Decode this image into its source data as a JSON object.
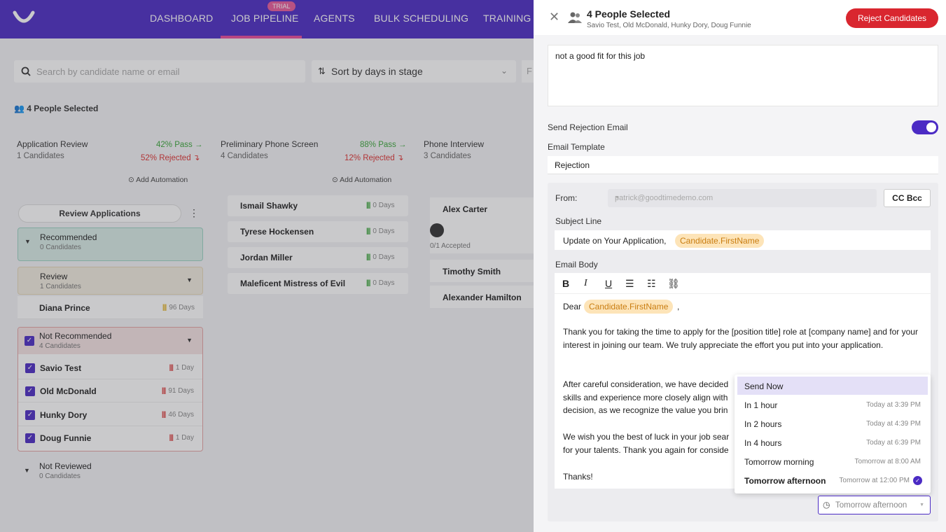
{
  "nav": {
    "items": [
      "DASHBOARD",
      "JOB PIPELINE",
      "AGENTS",
      "BULK SCHEDULING",
      "TRAINING"
    ],
    "badge": "TRIAL",
    "accent": "#4b2bc4"
  },
  "toolbar": {
    "search_placeholder": "Search by candidate name or email",
    "sort_label": "Sort by days in stage",
    "filter_label": "F"
  },
  "selection_label": "4 People Selected",
  "stages": [
    {
      "title": "Application Review",
      "count": "1 Candidates",
      "pass": "42% Pass →",
      "rejected": "52% Rejected ↴",
      "automation": "Add Automation"
    },
    {
      "title": "Preliminary Phone Screen",
      "count": "4 Candidates",
      "pass": "88% Pass →",
      "rejected": "12% Rejected ↴",
      "automation": "Add Automation"
    },
    {
      "title": "Phone Interview",
      "count": "3 Candidates"
    }
  ],
  "review_button": "Review Applications",
  "groups": {
    "recommended": {
      "title": "Recommended",
      "count": "0 Candidates"
    },
    "review": {
      "title": "Review",
      "count": "1 Candidates"
    },
    "not_recommended": {
      "title": "Not Recommended",
      "count": "4 Candidates"
    },
    "not_reviewed": {
      "title": "Not Reviewed",
      "count": "0 Candidates"
    }
  },
  "review_candidates": [
    {
      "name": "Diana Prince",
      "days": "96 Days"
    }
  ],
  "not_recommended_candidates": [
    {
      "name": "Savio Test",
      "days": "1 Day"
    },
    {
      "name": "Old McDonald",
      "days": "91 Days"
    },
    {
      "name": "Hunky Dory",
      "days": "46 Days"
    },
    {
      "name": "Doug Funnie",
      "days": "1 Day"
    }
  ],
  "phone_screen_candidates": [
    {
      "name": "Ismail Shawky",
      "days": "0 Days"
    },
    {
      "name": "Tyrese Hockensen",
      "days": "0 Days"
    },
    {
      "name": "Jordan Miller",
      "days": "0 Days"
    },
    {
      "name": "Maleficent Mistress of Evil",
      "days": "0 Days"
    }
  ],
  "interview": {
    "candidates": [
      "Alex Carter",
      "Timothy Smith",
      "Alexander Hamilton"
    ],
    "accepted": "0/1 Accepted"
  },
  "panel": {
    "title": "4 People Selected",
    "subtitle": "Savio Test, Old McDonald, Hunky Dory, Doug Funnie",
    "reject_button": "Reject Candidates",
    "note": "not a good fit for this job",
    "send_rejection_label": "Send Rejection Email",
    "send_rejection_on": true,
    "template_label": "Email Template",
    "template_value": "Rejection",
    "from_label": "From:",
    "from_value": "patrick@goodtimedemo.com",
    "cc_bcc": "CC Bcc",
    "subject_label": "Subject Line",
    "subject_text": "Update on Your Application,",
    "subject_token": "Candidate.FirstName",
    "body_label": "Email Body",
    "body": {
      "dear": "Dear",
      "token": "Candidate.FirstName",
      "comma": ",",
      "p1": "Thank you for taking the time to apply for the [position title] role at [company name] and for your interest in joining our team. We truly appreciate the effort you put into your application.",
      "p2a": "After careful consideration, we have decided",
      "p2b": "skills and experience more closely align with",
      "p2c": "decision, as we recognize the value you brin",
      "p3a": "We wish you the best of luck in your job sear",
      "p3b": "for your talents. Thank you again for conside",
      "thanks": "Thanks!"
    },
    "send_options": [
      {
        "label": "Send Now",
        "time": ""
      },
      {
        "label": "In 1 hour",
        "time": "Today at 3:39 PM"
      },
      {
        "label": "In 2 hours",
        "time": "Today at 4:39 PM"
      },
      {
        "label": "In 4 hours",
        "time": "Today at 6:39 PM"
      },
      {
        "label": "Tomorrow morning",
        "time": "Tomorrow at 8:00 AM"
      },
      {
        "label": "Tomorrow afternoon",
        "time": "Tomorrow at 12:00 PM"
      }
    ],
    "send_selected": "Tomorrow afternoon"
  }
}
